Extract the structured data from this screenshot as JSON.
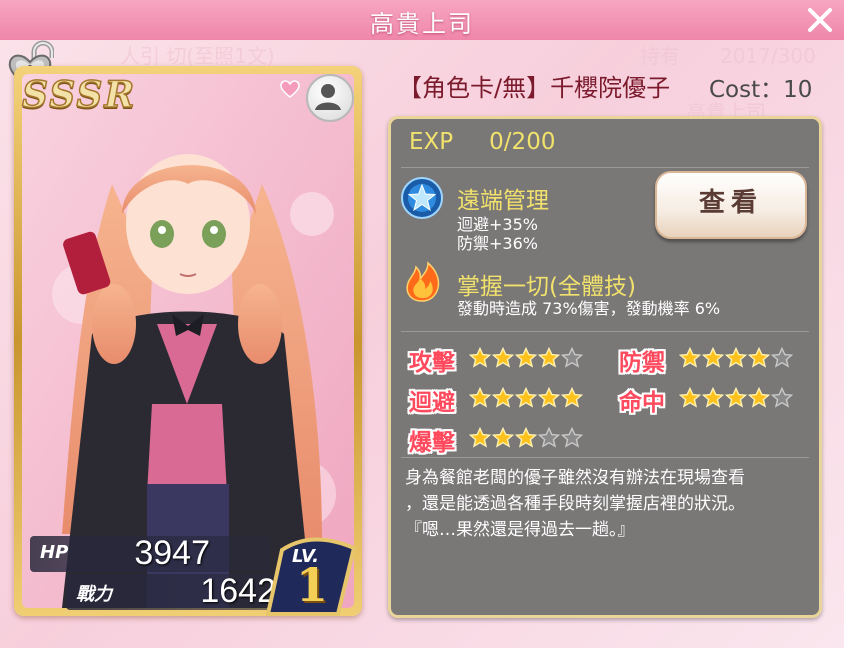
{
  "dialog": {
    "title": "高貴上司"
  },
  "card": {
    "rarity": "SSSR",
    "hp_label": "HP",
    "hp": "3947",
    "power_label": "戰力",
    "power": "1642",
    "level_label": "LV.",
    "level": "1"
  },
  "character": {
    "name": "【角色卡/無】千櫻院優子",
    "cost": "Cost：10"
  },
  "exp": {
    "label": "EXP",
    "value": "0/200"
  },
  "view_button": {
    "label": "查看"
  },
  "skills": [
    {
      "name": "遠端管理",
      "icon": "blue-star-badge-icon",
      "lines": [
        "迴避+35%",
        "防禦+36%"
      ]
    },
    {
      "name": "掌握一切(全體技)",
      "icon": "flame-icon",
      "lines": [
        "發動時造成 73%傷害，發動機率 6%"
      ]
    }
  ],
  "attributes": [
    {
      "label": "攻擊",
      "stars": 4,
      "max": 5
    },
    {
      "label": "防禦",
      "stars": 4,
      "max": 5
    },
    {
      "label": "迴避",
      "stars": 5,
      "max": 5
    },
    {
      "label": "命中",
      "stars": 4,
      "max": 5
    },
    {
      "label": "爆擊",
      "stars": 3,
      "max": 5
    }
  ],
  "description": [
    "身為餐館老闆的優子雖然沒有辦法在現場查看",
    "，還是能透過各種手段時刻掌握店裡的狀況。",
    "『嗯…果然還是得過去一趟。』"
  ],
  "colors": {
    "title_bar": "#ef86aa",
    "panel": "#7a7777",
    "accent_yellow": "#f1e26c",
    "attr_red": "#ff4a5e"
  }
}
